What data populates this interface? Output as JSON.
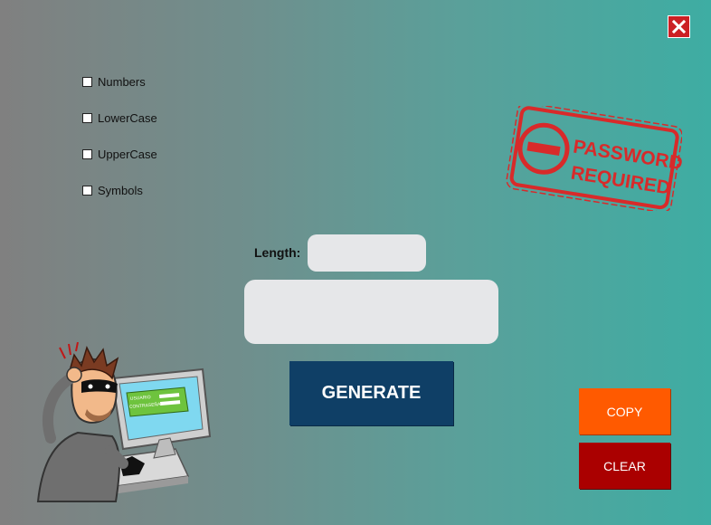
{
  "window": {
    "close_icon": "close-icon",
    "accent_close": "#cc1f24"
  },
  "options": [
    {
      "label": "Numbers",
      "checked": false
    },
    {
      "label": "LowerCase",
      "checked": false
    },
    {
      "label": "UpperCase",
      "checked": false
    },
    {
      "label": "Symbols",
      "checked": false
    }
  ],
  "length": {
    "label": "Length:",
    "value": ""
  },
  "output": {
    "value": ""
  },
  "buttons": {
    "generate": "GENERATE",
    "copy": "COPY",
    "clear": "CLEAR"
  },
  "stamp": {
    "line1": "PASSWORD",
    "line2": "REQUIRED"
  },
  "illustration": {
    "screen_line1": "USUARIO",
    "screen_line2": "CONTRASEÑA"
  },
  "colors": {
    "generate": "#0f3f66",
    "copy": "#ff5a00",
    "clear": "#aa0000",
    "stamp": "#d82a2a"
  }
}
